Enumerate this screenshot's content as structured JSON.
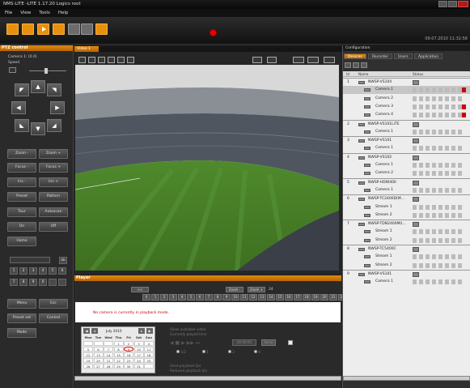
{
  "window": {
    "title": "NMS-LITE -LITE 1.17.20 Logics root"
  },
  "menu": [
    "File",
    "View",
    "Tools",
    "Help"
  ],
  "toolbar": {
    "clock": "09.07.2010 11:32:58"
  },
  "ptz": {
    "title": "PTZ control",
    "camera_label": "Camera 1: (0.0)",
    "speed_label": "Speed",
    "speed_value": 0.45,
    "arrows": [
      "◤",
      "▲",
      "◥",
      "◀",
      "▶",
      "◣",
      "▼",
      "◢"
    ],
    "buttons": [
      [
        "Zoom -",
        "Zoom +"
      ],
      [
        "Focus -",
        "Focus +"
      ],
      [
        "Iris -",
        "Iris +"
      ],
      [
        "Preset",
        "Pattern"
      ],
      [
        "Tour",
        "Autoscan"
      ],
      [
        "On",
        "Off"
      ],
      [
        "Home",
        ""
      ]
    ],
    "keypad": [
      "1",
      "2",
      "3",
      "4",
      "5",
      "6",
      "7",
      "8",
      "9",
      "0",
      "",
      ""
    ],
    "ok_label": "ok",
    "bottom_buttons": [
      [
        "Menu",
        "Esc"
      ],
      [
        "Preset set",
        "Control"
      ],
      [
        "Mode",
        ""
      ]
    ]
  },
  "video": {
    "tab": "Video 1"
  },
  "player": {
    "title": "Player",
    "zoom_minus": "Zoom -",
    "zoom_plus": "Zoom +",
    "zoom_value": "24",
    "hours": [
      "0",
      "1",
      "2",
      "3",
      "4",
      "5",
      "6",
      "7",
      "8",
      "9",
      "10",
      "11",
      "12",
      "13",
      "14",
      "15",
      "16",
      "17",
      "18",
      "19",
      "20",
      "21",
      "22"
    ],
    "no_camera_msg": "No camera is currently in playback mode.",
    "calendar": {
      "month": "July 2010",
      "weekdays": [
        "Mon",
        "Tue",
        "Wed",
        "Thu",
        "Fri",
        "Sat",
        "Sun"
      ],
      "days": [
        [
          "",
          "",
          "",
          "1",
          "2",
          "3",
          "4"
        ],
        [
          "5",
          "6",
          "7",
          "8",
          "9",
          "10",
          "11"
        ],
        [
          "12",
          "13",
          "14",
          "15",
          "16",
          "17",
          "18"
        ],
        [
          "19",
          "20",
          "21",
          "22",
          "23",
          "24",
          "25"
        ],
        [
          "26",
          "27",
          "28",
          "29",
          "30",
          "31",
          ""
        ]
      ],
      "today": "9"
    },
    "info_labels": [
      "Show available video",
      "Currently played time"
    ],
    "time_value": "00:00:00",
    "goto_label": "Go to",
    "speed_options": [
      "1/2",
      "1",
      "2",
      "4"
    ],
    "footer_labels": [
      "Used playback fps",
      "Reduced playback fps"
    ]
  },
  "config": {
    "title": "Configuration",
    "tabs": [
      "Devices",
      "Recorder",
      "Users",
      "Application"
    ],
    "col_id": "Id",
    "col_name": "Name",
    "col_status": "Status",
    "rows": [
      {
        "id": "1",
        "name": "NWSP-VS104",
        "level": 0
      },
      {
        "id": "",
        "name": "Camera 1",
        "level": 1,
        "selected": true
      },
      {
        "id": "",
        "name": "Camera 2",
        "level": 1
      },
      {
        "id": "",
        "name": "Camera 3",
        "level": 1
      },
      {
        "id": "",
        "name": "Camera 4",
        "level": 1
      },
      {
        "id": "2",
        "name": "NWSP-VS101LITE",
        "level": 0
      },
      {
        "id": "",
        "name": "Camera 1",
        "level": 1
      },
      {
        "id": "3",
        "name": "NWSP-VS101",
        "level": 0
      },
      {
        "id": "",
        "name": "Camera 1",
        "level": 1
      },
      {
        "id": "4",
        "name": "NWSP-VS102",
        "level": 0
      },
      {
        "id": "",
        "name": "Camera 1",
        "level": 1
      },
      {
        "id": "",
        "name": "Camera 2",
        "level": 1
      },
      {
        "id": "5",
        "name": "NWSP-HDW400",
        "level": 0
      },
      {
        "id": "",
        "name": "Camera 1",
        "level": 1
      },
      {
        "id": "6",
        "name": "NWSP-TC2400D(M...",
        "level": 0
      },
      {
        "id": "",
        "name": "Stream 1",
        "level": 1
      },
      {
        "id": "",
        "name": "Stream 2",
        "level": 1
      },
      {
        "id": "7",
        "name": "NWSP-TDN2400M(I...",
        "level": 0
      },
      {
        "id": "",
        "name": "Stream 1",
        "level": 1
      },
      {
        "id": "",
        "name": "Stream 2",
        "level": 1
      },
      {
        "id": "8",
        "name": "NWSP-TC5400C",
        "level": 0
      },
      {
        "id": "",
        "name": "Stream 1",
        "level": 1
      },
      {
        "id": "",
        "name": "Stream 2",
        "level": 1
      },
      {
        "id": "9",
        "name": "NWSP-VS101",
        "level": 0
      },
      {
        "id": "",
        "name": "Camera 1",
        "level": 1
      }
    ]
  },
  "colors": {
    "accent": "#e8900c",
    "record": "#e00000",
    "error_text": "#cc0000",
    "selected_row": "#c6c6c6"
  }
}
